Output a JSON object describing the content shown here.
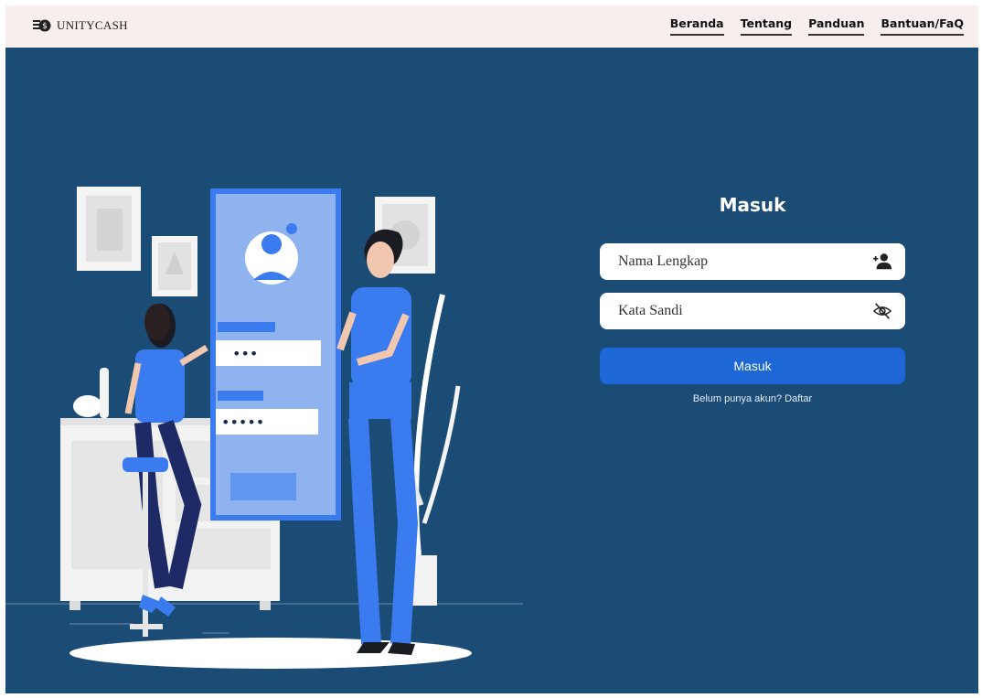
{
  "brand": {
    "name": "UNITYCASH",
    "logo_icon": "money-coin-icon"
  },
  "nav": {
    "items": [
      {
        "label": "Beranda"
      },
      {
        "label": "Tentang"
      },
      {
        "label": "Panduan"
      },
      {
        "label": "Bantuan/FaQ"
      }
    ]
  },
  "illustration": {
    "password_short": "•••",
    "password_long": "•••••"
  },
  "login": {
    "title": "Masuk",
    "name_placeholder": "Nama Lengkap",
    "name_icon": "add-user-icon",
    "password_placeholder": "Kata Sandi",
    "password_icon": "eye-off-icon",
    "submit_label": "Masuk",
    "register_text": "Belum punya akun? Daftar"
  },
  "colors": {
    "topbar": "#f8eeee",
    "background": "#1b4c76",
    "accent": "#1d67d6",
    "illustration_blue": "#3a7bf0"
  }
}
